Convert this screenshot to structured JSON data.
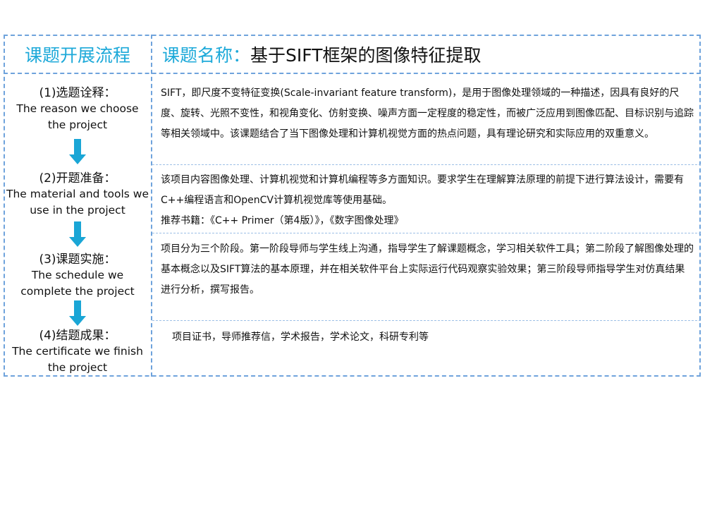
{
  "header": {
    "left_title": "课题开展流程",
    "label": "课题名称：",
    "title": "基于SIFT框架的图像特征提取"
  },
  "steps": [
    {
      "zh": "(1)选题诠释：",
      "en_lines": [
        "The reason we choose",
        "the project"
      ]
    },
    {
      "zh": "(2)开题准备：",
      "en_lines": [
        "The material and tools we",
        "use in the project"
      ]
    },
    {
      "zh": "(3)课题实施：",
      "en_lines": [
        "The schedule we",
        "complete the project"
      ]
    },
    {
      "zh": "(4)结题成果：",
      "en_lines": [
        "The certificate we finish",
        "the project"
      ]
    }
  ],
  "contents": [
    [
      "SIFT，即尺度不变特征变换(Scale-invariant feature transform)，是用于图像处理领域的一种描述，因具有良好的尺度、旋转、光照不变性，和视角变化、仿射变换、噪声方面一定程度的稳定性，而被广泛应用到图像匹配、目标识别与追踪等相关领域中。该课题结合了当下图像处理和计算机视觉方面的热点问题，具有理论研究和实际应用的双重意义。"
    ],
    [
      "该项目内容图像处理、计算机视觉和计算机编程等多方面知识。要求学生在理解算法原理的前提下进行算法设计，需要有C++编程语言和OpenCV计算机视觉库等使用基础。",
      "推荐书籍：《C++ Primer（第4版）》，《数字图像处理》"
    ],
    [
      "项目分为三个阶段。第一阶段导师与学生线上沟通，指导学生了解课题概念，学习相关软件工具；第二阶段了解图像处理的基本概念以及SIFT算法的基本原理，并在相关软件平台上实际运行代码观察实验效果；第三阶段导师指导学生对仿真结果进行分析，撰写报告。"
    ],
    [
      "项目证书，导师推荐信，学术报告，学术论文，科研专利等"
    ]
  ],
  "colors": {
    "accent": "#1da9d9",
    "border": "#6fa3dc",
    "arrow": "#1aa6d6"
  }
}
